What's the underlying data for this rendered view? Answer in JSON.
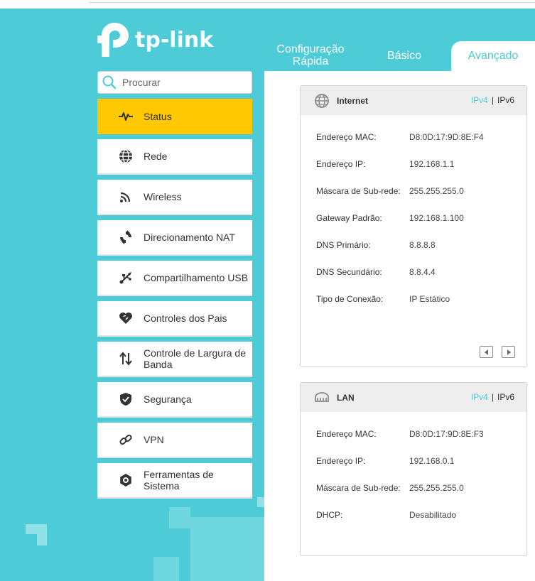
{
  "brand": {
    "name": "tp-link"
  },
  "tabs": [
    {
      "label": "Configuração Rápida"
    },
    {
      "label": "Básico"
    },
    {
      "label": "Avançado"
    }
  ],
  "search": {
    "placeholder": "Procurar",
    "icon": "search-icon"
  },
  "nav": {
    "items": [
      {
        "label": "Status",
        "icon": "pulse-icon",
        "active": true
      },
      {
        "label": "Rede",
        "icon": "globe-icon"
      },
      {
        "label": "Wireless",
        "icon": "wifi-icon"
      },
      {
        "label": "Direcionamento NAT",
        "icon": "nat-icon"
      },
      {
        "label": "Compartilhamento USB",
        "icon": "usb-icon"
      },
      {
        "label": "Controles dos Pais",
        "icon": "heart-icon"
      },
      {
        "label": "Controle de Largura de Banda",
        "icon": "updown-arrows-icon"
      },
      {
        "label": "Segurança",
        "icon": "shield-icon"
      },
      {
        "label": "VPN",
        "icon": "link-icon"
      },
      {
        "label": "Ferramentas de Sistema",
        "icon": "gear-icon"
      }
    ]
  },
  "internet": {
    "title": "Internet",
    "ipv4": "IPv4",
    "separator": "|",
    "ipv6": "IPv6",
    "rows": [
      {
        "label": "Endereço MAC:",
        "value": "D8:0D:17:9D:8E:F4"
      },
      {
        "label": "Endereço IP:",
        "value": "192.168.1.1"
      },
      {
        "label": "Máscara de Sub-rede:",
        "value": "255.255.255.0"
      },
      {
        "label": "Gateway Padrão:",
        "value": "192.168.1.100"
      },
      {
        "label": "DNS Primário:",
        "value": "8.8.8.8"
      },
      {
        "label": "DNS Secundário:",
        "value": "8.8.4.4"
      },
      {
        "label": "Tipo de Conexão:",
        "value": "IP Estático"
      }
    ]
  },
  "lan": {
    "title": "LAN",
    "ipv4": "IPv4",
    "separator": "|",
    "ipv6": "IPv6",
    "rows": [
      {
        "label": "Endereço MAC:",
        "value": "D8:0D:17:9D:8E:F3"
      },
      {
        "label": "Endereço IP:",
        "value": "192.168.0.1"
      },
      {
        "label": "Máscara de Sub-rede:",
        "value": "255.255.255.0"
      },
      {
        "label": "DHCP:",
        "value": "Desabilitado"
      }
    ]
  },
  "colors": {
    "accent": "#4dcbd6",
    "active": "#ffc800",
    "text": "#333333"
  }
}
